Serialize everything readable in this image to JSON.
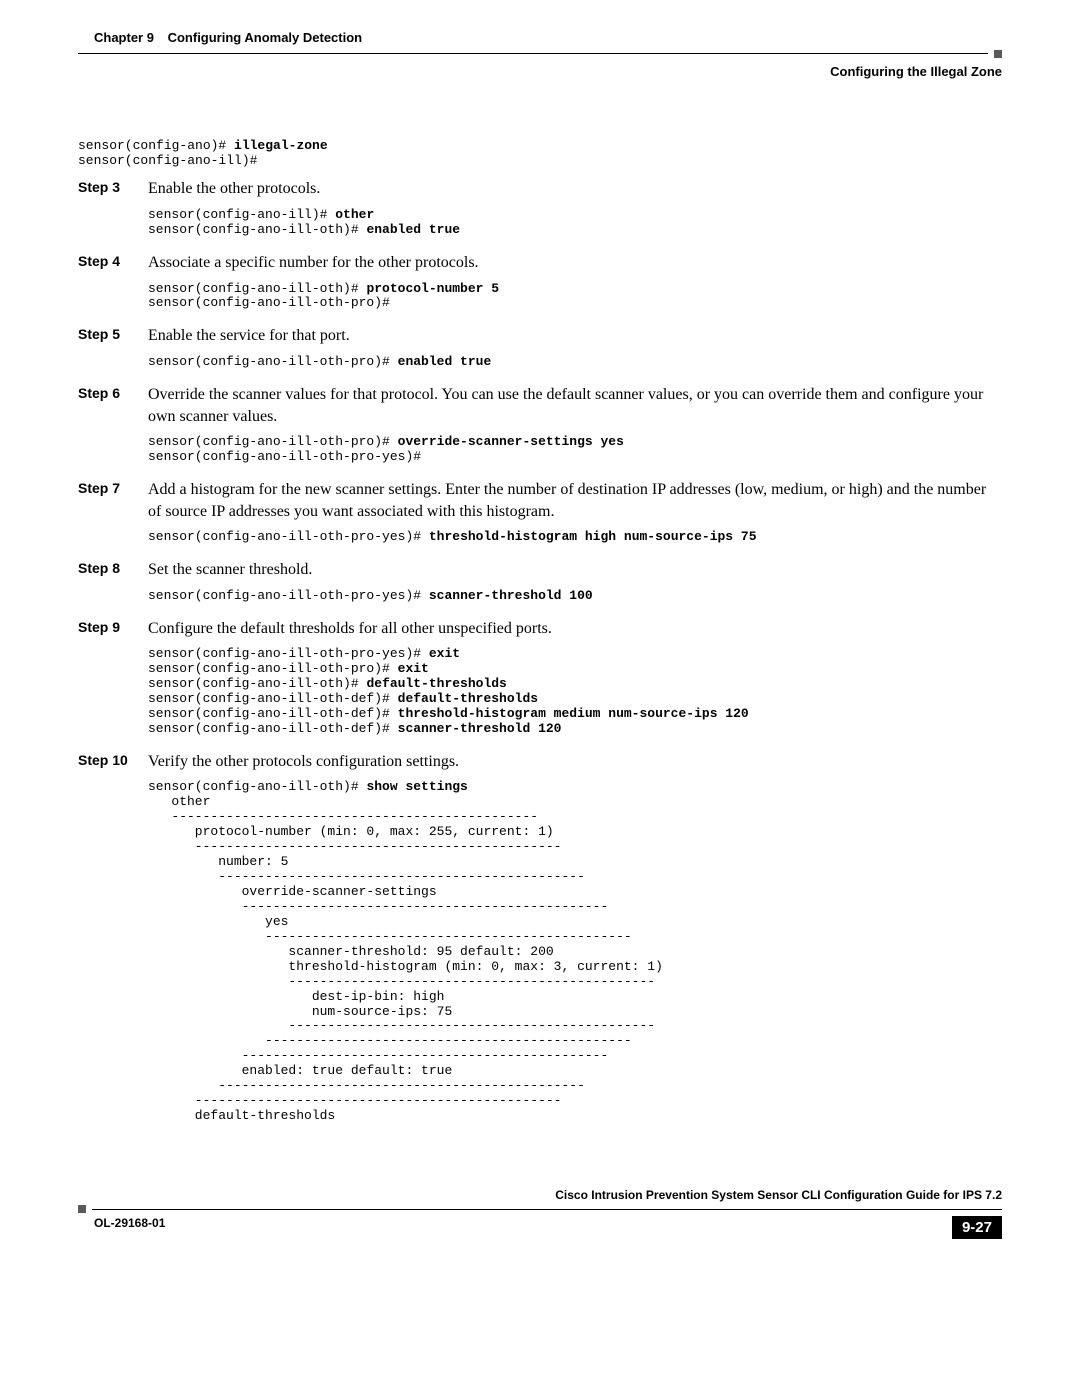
{
  "header": {
    "chapter": "Chapter 9",
    "chapter_title": "Configuring Anomaly Detection",
    "section_title": "Configuring the Illegal Zone"
  },
  "code_intro": "sensor(config-ano)# illegal-zone\nsensor(config-ano-ill)#",
  "steps": {
    "3": {
      "label": "Step 3",
      "text": "Enable the other protocols.",
      "code": "sensor(config-ano-ill)# other\nsensor(config-ano-ill-oth)# enabled true"
    },
    "4": {
      "label": "Step 4",
      "text": "Associate a specific number for the other protocols.",
      "code": "sensor(config-ano-ill-oth)# protocol-number 5\nsensor(config-ano-ill-oth-pro)#"
    },
    "5": {
      "label": "Step 5",
      "text": "Enable the service for that port.",
      "code": "sensor(config-ano-ill-oth-pro)# enabled true"
    },
    "6": {
      "label": "Step 6",
      "text": "Override the scanner values for that protocol. You can use the default scanner values, or you can override them and configure your own scanner values.",
      "code": "sensor(config-ano-ill-oth-pro)# override-scanner-settings yes\nsensor(config-ano-ill-oth-pro-yes)#"
    },
    "7": {
      "label": "Step 7",
      "text": "Add a histogram for the new scanner settings. Enter the number of destination IP addresses (low, medium, or high) and the number of source IP addresses you want associated with this histogram.",
      "code": "sensor(config-ano-ill-oth-pro-yes)# threshold-histogram high num-source-ips 75"
    },
    "8": {
      "label": "Step 8",
      "text": "Set the scanner threshold.",
      "code": "sensor(config-ano-ill-oth-pro-yes)# scanner-threshold 100"
    },
    "9": {
      "label": "Step 9",
      "text": "Configure the default thresholds for all other unspecified ports.",
      "code": "sensor(config-ano-ill-oth-pro-yes)# exit\nsensor(config-ano-ill-oth-pro)# exit\nsensor(config-ano-ill-oth)# default-thresholds\nsensor(config-ano-ill-oth-def)# default-thresholds\nsensor(config-ano-ill-oth-def)# threshold-histogram medium num-source-ips 120\nsensor(config-ano-ill-oth-def)# scanner-threshold 120"
    },
    "10": {
      "label": "Step 10",
      "text": "Verify the other protocols configuration settings.",
      "code": "sensor(config-ano-ill-oth)# show settings\n   other\n   -----------------------------------------------\n      protocol-number (min: 0, max: 255, current: 1)\n      -----------------------------------------------\n         number: 5\n         -----------------------------------------------\n            override-scanner-settings\n            -----------------------------------------------\n               yes\n               -----------------------------------------------\n                  scanner-threshold: 95 default: 200\n                  threshold-histogram (min: 0, max: 3, current: 1)\n                  -----------------------------------------------\n                     dest-ip-bin: high\n                     num-source-ips: 75\n                  -----------------------------------------------\n               -----------------------------------------------\n            -----------------------------------------------\n            enabled: true default: true\n         -----------------------------------------------\n      -----------------------------------------------\n      default-thresholds"
    }
  },
  "bold_map": {
    "illegal-zone": true,
    "other": true,
    "enabled true": true,
    "protocol-number 5": true,
    "override-scanner-settings yes": true,
    "threshold-histogram high num-source-ips 75": true,
    "scanner-threshold 100": true,
    "exit": true,
    "default-thresholds": true,
    "threshold-histogram medium num-source-ips 120": true,
    "scanner-threshold 120": true,
    "show settings": true
  },
  "footer": {
    "guide_title": "Cisco Intrusion Prevention System Sensor CLI Configuration Guide for IPS 7.2",
    "doc_num": "OL-29168-01",
    "page_num": "9-27"
  }
}
